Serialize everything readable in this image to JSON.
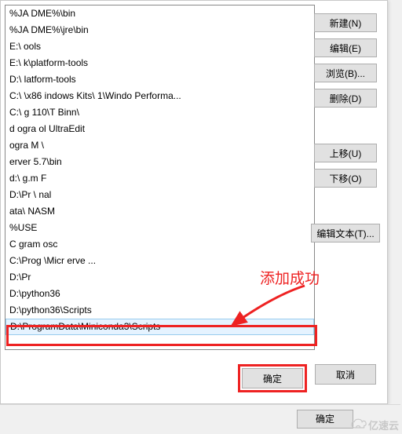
{
  "list": {
    "items": [
      {
        "display": "%JA            DME%\\bin"
      },
      {
        "display": "%JA          DME%\\jre\\bin"
      },
      {
        "display": "E:\\                                          ools"
      },
      {
        "display": "E:\\                                  k\\platform-tools"
      },
      {
        "display": "D:\\                                                         latform-tools"
      },
      {
        "display": "C:\\               \\x86  indows Kits\\  1\\Windo   Performa..."
      },
      {
        "display": "C:\\   g                                    110\\T       Binn\\"
      },
      {
        "display": "d    ogra                                       ol        UltraEdit"
      },
      {
        "display": "     ogra          M                                          \\"
      },
      {
        "display": "                                        erver 5.7\\bin"
      },
      {
        "display": "d:\\    g.m   F"
      },
      {
        "display": "D:\\Pr              \\         nal"
      },
      {
        "display": "                           ata\\     NASM"
      },
      {
        "display": "%USE"
      },
      {
        "display": "C     gram           osc"
      },
      {
        "display": "C:\\Prog         \\Micr            erve                            ..."
      },
      {
        "display": "D:\\Pr"
      },
      {
        "display": "D:\\python36"
      },
      {
        "display": "D:\\python36\\Scripts"
      },
      {
        "display": "D:\\ProgramData\\Miniconda3\\Scripts",
        "selected": true
      }
    ]
  },
  "buttons": {
    "new": "新建(N)",
    "edit": "编辑(E)",
    "browse": "浏览(B)...",
    "delete": "删除(D)",
    "moveUp": "上移(U)",
    "moveDown": "下移(O)",
    "editText": "编辑文本(T)...",
    "ok": "确定",
    "cancel": "取消",
    "ok2": "确定"
  },
  "annotation": "添加成功",
  "watermark": "亿速云"
}
